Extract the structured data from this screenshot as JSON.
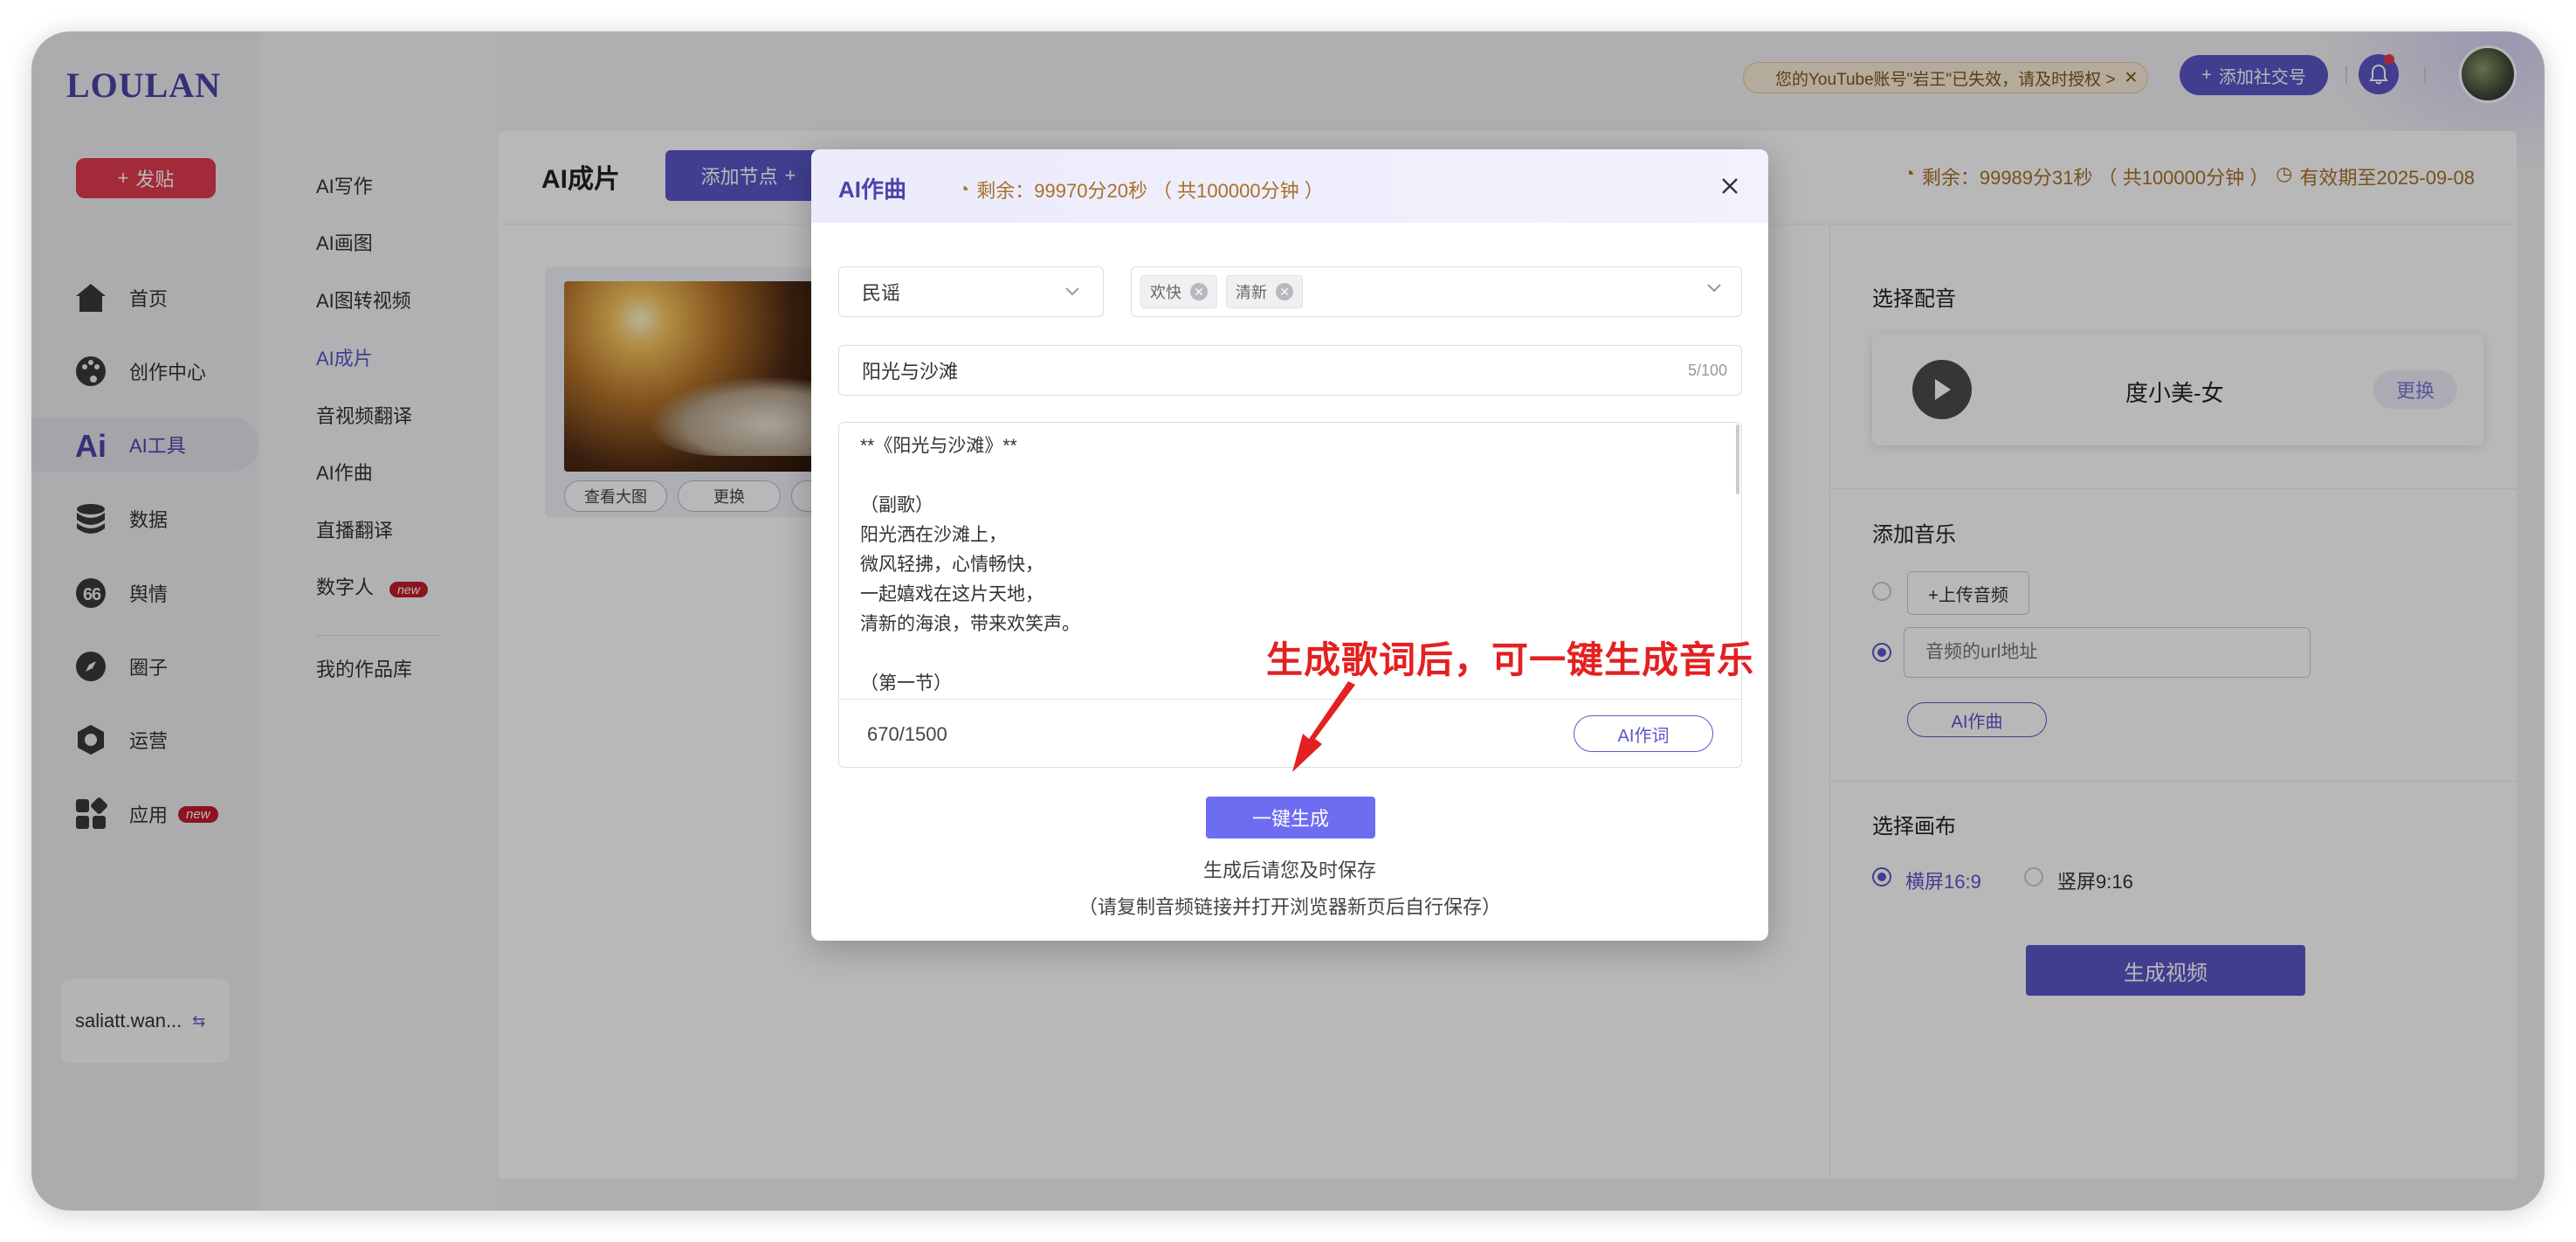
{
  "app": {
    "logo": "LOULAN"
  },
  "sidebar": {
    "post_label": "发贴",
    "items": [
      {
        "label": "首页",
        "icon": "home-icon"
      },
      {
        "label": "创作中心",
        "icon": "palette-icon"
      },
      {
        "label": "AI工具",
        "icon": "ai-icon",
        "active": true
      },
      {
        "label": "数据",
        "icon": "database-icon"
      },
      {
        "label": "舆情",
        "icon": "sentiment-icon"
      },
      {
        "label": "圈子",
        "icon": "compass-icon"
      },
      {
        "label": "运营",
        "icon": "operations-icon"
      },
      {
        "label": "应用",
        "icon": "apps-icon",
        "badge": "new"
      }
    ],
    "user": "saliatt.wan..."
  },
  "subnav": {
    "items": [
      {
        "label": "AI写作"
      },
      {
        "label": "AI画图"
      },
      {
        "label": "AI图转视频"
      },
      {
        "label": "AI成片",
        "active": true
      },
      {
        "label": "音视频翻译"
      },
      {
        "label": "AI作曲"
      },
      {
        "label": "直播翻译"
      },
      {
        "label": "数字人",
        "badge": "new"
      },
      {
        "label": "我的作品库"
      }
    ]
  },
  "topbar": {
    "alert": "您的YouTube账号\"岩王\"已失效，请及时授权 >",
    "add_account": "添加社交号"
  },
  "main": {
    "title": "AI成片",
    "add_node": "添加节点",
    "remaining": "剩余：99989分31秒 （ 共100000分钟 ）",
    "expiry": "有效期至2025-09-08",
    "card_view": "查看大图",
    "card_change": "更换",
    "voice_section": "选择配音",
    "voice_name": "度小美-女",
    "voice_change": "更换",
    "music_section": "添加音乐",
    "upload_audio": "+上传音频",
    "url_placeholder": "音频的url地址",
    "ai_compose": "AI作曲",
    "canvas_section": "选择画布",
    "canvas_landscape": "横屏16:9",
    "canvas_portrait": "竖屏9:16",
    "generate_video": "生成视频"
  },
  "modal": {
    "title": "AI作曲",
    "remaining": "剩余：99970分20秒 （ 共100000分钟 ）",
    "genre": "民谣",
    "tags": [
      "欢快",
      "清新"
    ],
    "song_title": "阳光与沙滩",
    "title_count": "5/100",
    "lyrics": "**《阳光与沙滩》**\n\n（副歌）\n阳光洒在沙滩上，\n微风轻拂，心情畅快，\n一起嬉戏在这片天地，\n清新的海浪，带来欢笑声。\n\n（第一节）",
    "lyrics_count": "670/1500",
    "ai_lyrics": "AI作词",
    "generate": "一键生成",
    "note1": "生成后请您及时保存",
    "note2": "（请复制音频链接并打开浏览器新页后自行保存）"
  },
  "annotation": "生成歌词后，可一键生成音乐",
  "colors": {
    "accent": "#5b57c8",
    "danger": "#e23b4f",
    "warning_text": "#a8702a",
    "annotation": "#e42020"
  }
}
